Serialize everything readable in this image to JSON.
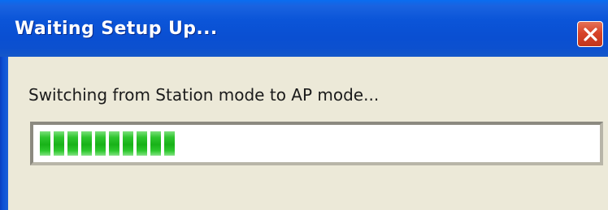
{
  "dialog": {
    "title": "Waiting Setup Up...",
    "message": "Switching from Station mode to AP mode...",
    "close_icon": "close-x-icon",
    "progress": {
      "percent": 26,
      "color": "#1ab01a"
    }
  },
  "colors": {
    "titlebar": "#0b55d8",
    "title_text": "#ffffff",
    "close_button": "#d8442a",
    "dialog_background": "#ece9d8"
  }
}
